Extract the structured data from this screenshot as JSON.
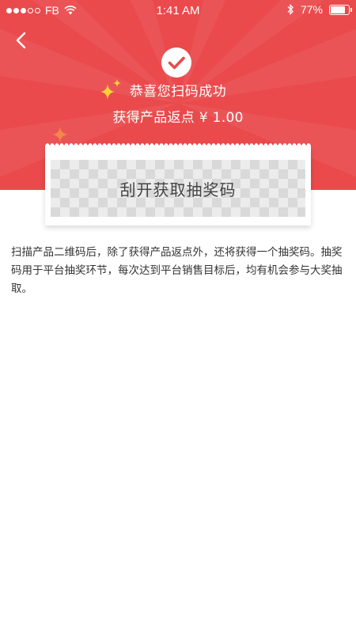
{
  "status_bar": {
    "carrier": "FB",
    "time": "1:41 AM",
    "battery": "77%",
    "battery_level": 0.77
  },
  "header": {
    "back_icon": "chevron-left-icon",
    "success_icon": "check-circle-icon",
    "title": "恭喜您扫码成功",
    "rebate": "获得产品返点 ¥ 1.00"
  },
  "ticket": {
    "scratch_label": "刮开获取抽奖码"
  },
  "description": "扫描产品二维码后，除了获得产品返点外，还将获得一个抽奖码。抽奖码用于平台抽奖环节，每次达到平台销售目标后，均有机会参与大奖抽取。",
  "colors": {
    "brand_red": "#ea4a4c",
    "sparkle_yellow": "#f7d23a",
    "sparkle_orange": "#f2874a"
  }
}
